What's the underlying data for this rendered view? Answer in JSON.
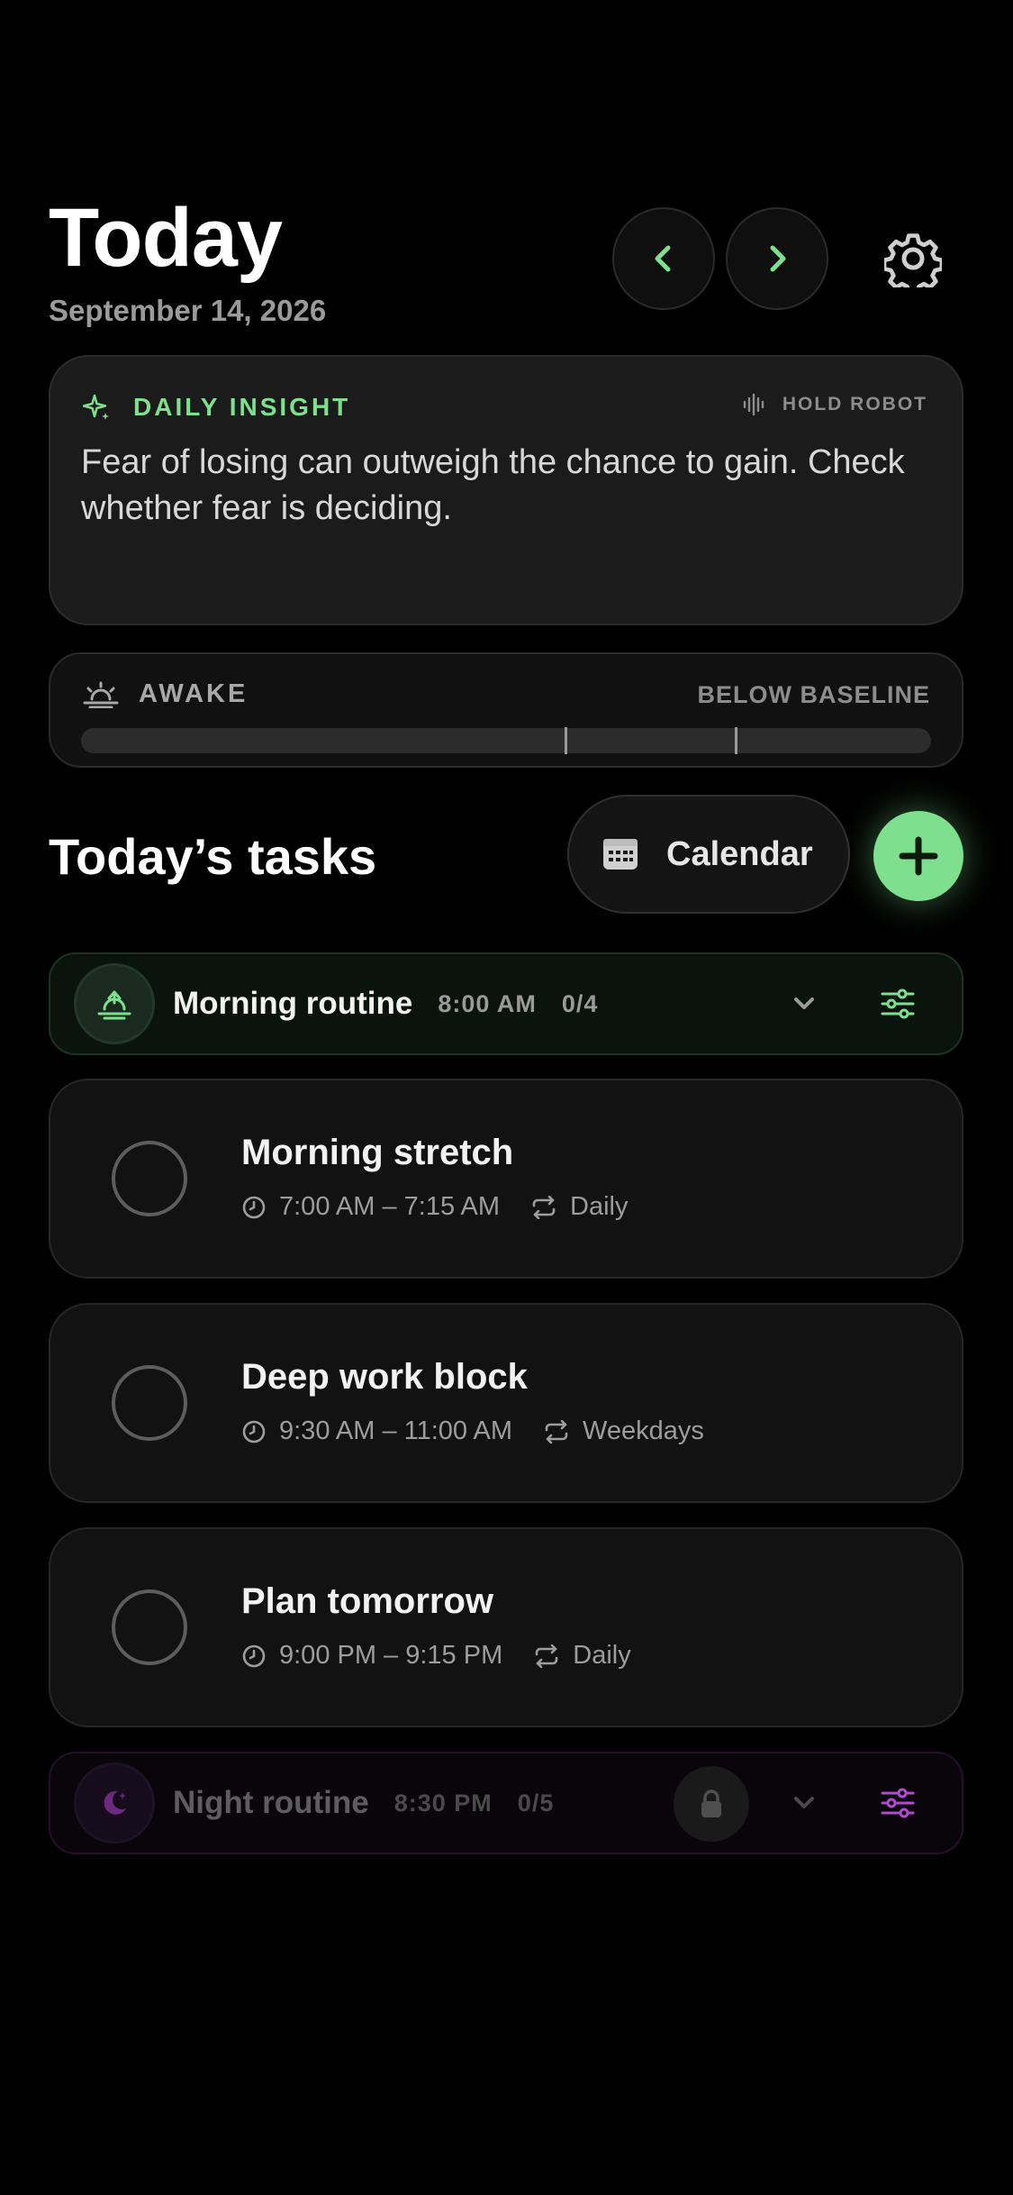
{
  "header": {
    "title": "Today",
    "date": "September 14, 2026"
  },
  "insight": {
    "label": "DAILY INSIGHT",
    "hold_label": "HOLD ROBOT",
    "text": "Fear of losing can outweigh the chance to gain. Check whether fear is deciding."
  },
  "awake": {
    "label": "AWAKE",
    "status": "BELOW BASELINE"
  },
  "tasks_section": {
    "title": "Today’s tasks",
    "calendar_label": "Calendar"
  },
  "morning_routine": {
    "name": "Morning routine",
    "time": "8:00 AM",
    "progress": "0/4"
  },
  "tasks": [
    {
      "name": "Morning stretch",
      "time": "7:00 AM – 7:15 AM",
      "repeat": "Daily"
    },
    {
      "name": "Deep work block",
      "time": "9:30 AM – 11:00 AM",
      "repeat": "Weekdays"
    },
    {
      "name": "Plan tomorrow",
      "time": "9:00 PM – 9:15 PM",
      "repeat": "Daily"
    }
  ],
  "night_routine": {
    "name": "Night routine",
    "time": "8:30 PM",
    "progress": "0/5"
  },
  "colors": {
    "accent_green": "#7ee08e",
    "accent_purple": "#b04ad0",
    "background": "#000000"
  },
  "icons": [
    "chevron-left-icon",
    "chevron-right-icon",
    "gear-icon",
    "sparkle-icon",
    "waveform-icon",
    "sunrise-icon",
    "calendar-icon",
    "plus-icon",
    "chevron-down-icon",
    "sliders-icon",
    "clock-icon",
    "repeat-icon",
    "moon-icon",
    "lock-icon"
  ]
}
